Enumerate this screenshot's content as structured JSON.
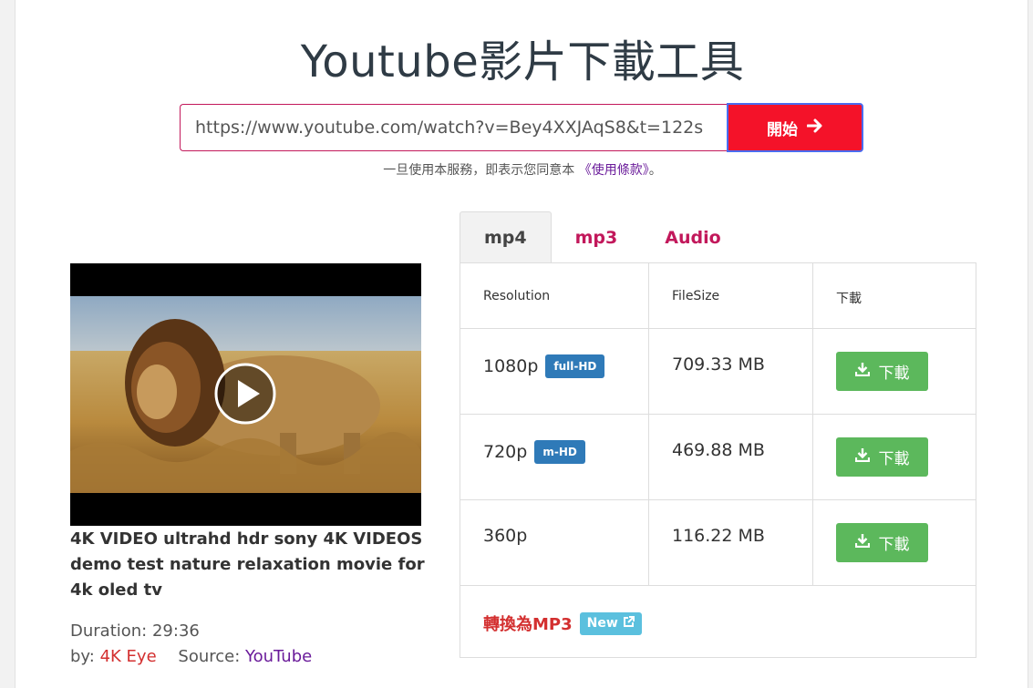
{
  "header": {
    "title": "Youtube影片下載工具"
  },
  "search": {
    "url_value": "https://www.youtube.com/watch?v=Bey4XXJAqS8&t=122s",
    "start_label": "開始"
  },
  "terms": {
    "prefix": "一旦使用本服務，即表示您同意本 ",
    "link": "《使用條款》",
    "suffix": "。"
  },
  "tabs": [
    {
      "label": "mp4"
    },
    {
      "label": "mp3"
    },
    {
      "label": "Audio"
    }
  ],
  "table": {
    "headers": {
      "resolution": "Resolution",
      "filesize": "FileSize",
      "download": "下載"
    },
    "rows": [
      {
        "resolution": "1080p",
        "badge": "full-HD",
        "size": "709.33 MB",
        "button": "下載"
      },
      {
        "resolution": "720p",
        "badge": "m-HD",
        "size": "469.88 MB",
        "button": "下載"
      },
      {
        "resolution": "360p",
        "badge": "",
        "size": "116.22 MB",
        "button": "下載"
      }
    ],
    "mp3_convert": {
      "label": "轉換為MP3",
      "badge": "New"
    }
  },
  "video": {
    "title": "4K VIDEO ultrahd hdr sony 4K VIDEOS demo test nature relaxation movie for 4k oled tv",
    "duration_label": "Duration:",
    "duration": "29:36",
    "by_label": "by:",
    "author": "4K Eye",
    "source_label": "Source:",
    "source": "YouTube"
  },
  "colors": {
    "start_button": "#f41229",
    "download_button": "#5cb85c",
    "badge_blue": "#2f7ab8",
    "new_badge": "#5bc0de",
    "tab_accent": "#c2185b",
    "link_purple": "#6a1b9a"
  }
}
